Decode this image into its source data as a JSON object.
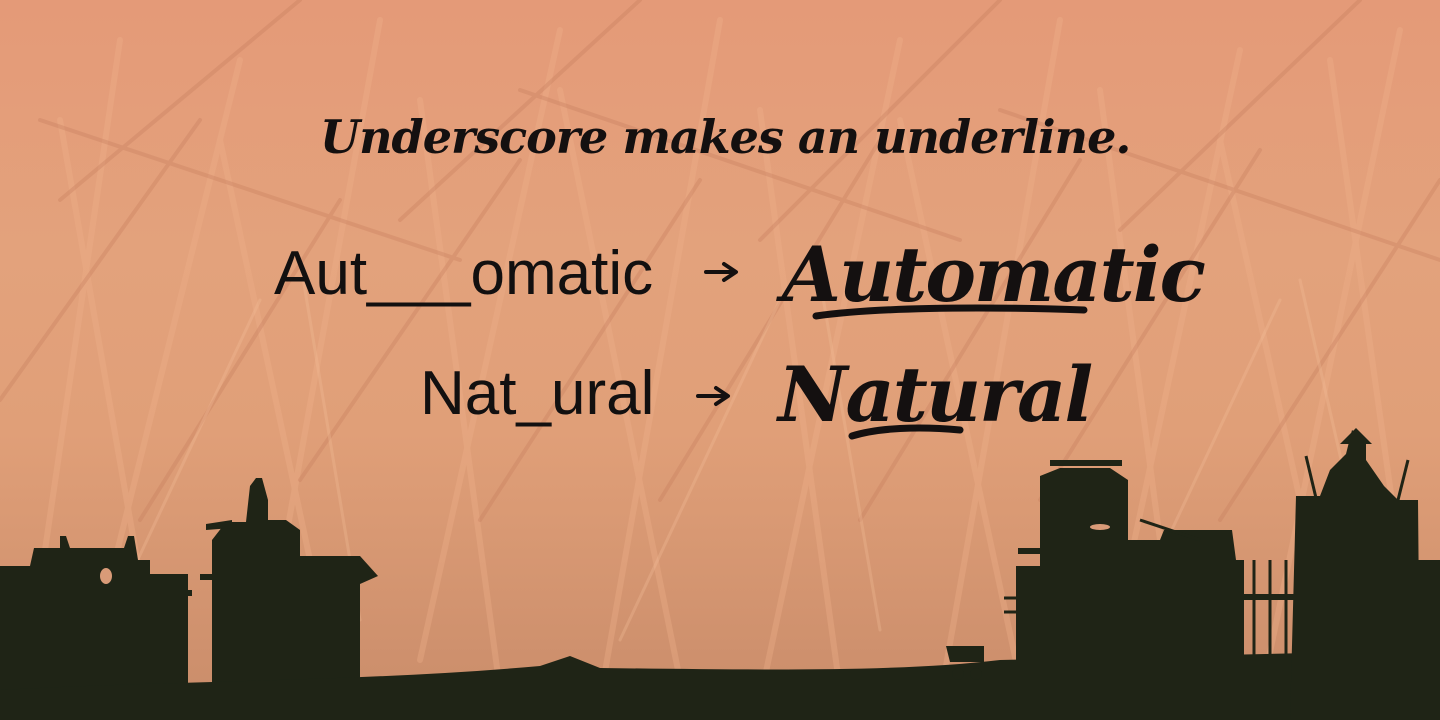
{
  "headline": "Underscore makes an underline.",
  "examples": [
    {
      "input": "Aut___omatic",
      "result": "Automatic"
    },
    {
      "input": "Nat_ural",
      "result": "Natural"
    }
  ],
  "colors": {
    "background": "#e3a27c",
    "grass": "#d98a68",
    "text": "#141010",
    "silhouette": "#1f2416"
  },
  "icons": {
    "arrow": "right-arrow-icon"
  }
}
